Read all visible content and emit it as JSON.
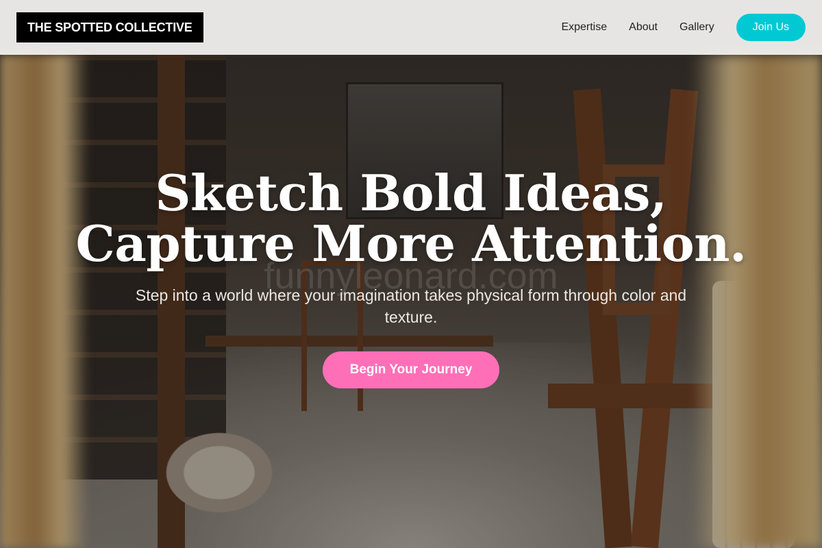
{
  "brand": {
    "logo_text": "THE SPOTTED COLLECTIVE"
  },
  "nav": {
    "links": [
      {
        "label": "Expertise"
      },
      {
        "label": "About"
      },
      {
        "label": "Gallery"
      }
    ],
    "cta_label": "Join Us"
  },
  "hero": {
    "headline_line1": "Sketch Bold Ideas,",
    "headline_line2": "Capture More Attention.",
    "subtitle": "Step into a world where your imagination takes physical form through color and texture.",
    "cta_label": "Begin Your Journey"
  },
  "watermark": {
    "text": "funnyleonard.com"
  },
  "colors": {
    "accent_cyan": "#00c9d4",
    "accent_pink": "#ff6fb8",
    "logo_bg": "#000000",
    "header_bg": "#f5f4f2"
  }
}
